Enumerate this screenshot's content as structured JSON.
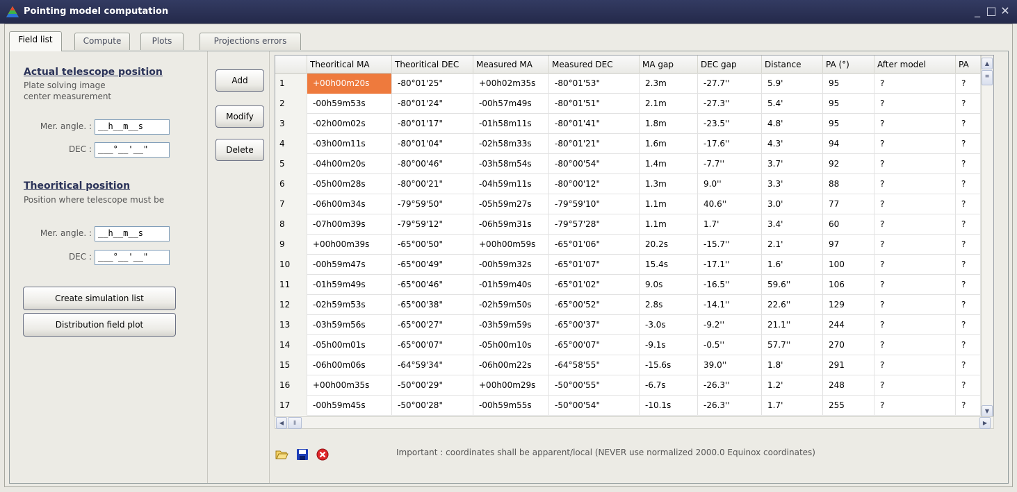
{
  "window": {
    "title": "Pointing model computation"
  },
  "tabs": [
    {
      "label": "Field list"
    },
    {
      "label": "Compute"
    },
    {
      "label": "Plots"
    },
    {
      "label": "Projections errors"
    }
  ],
  "left": {
    "actual_title": "Actual telescope position",
    "actual_desc1": "Plate solving image",
    "actual_desc2": "center measurement",
    "mer_label": "Mer. angle. :",
    "dec_label": "DEC :",
    "mer_placeholder": "__h__m__s",
    "dec_placeholder": "___°__'__\"",
    "theo_title": "Theoritical position",
    "theo_desc": "Position where telescope must be",
    "create_btn": "Create simulation list",
    "dist_btn": "Distribution field plot"
  },
  "actions": {
    "add": "Add",
    "modify": "Modify",
    "delete": "Delete"
  },
  "grid": {
    "columns": [
      "",
      "Theoritical MA",
      "Theoritical DEC",
      "Measured MA",
      "Measured DEC",
      "MA gap",
      "DEC gap",
      "Distance",
      "PA (°)",
      "After model",
      "PA"
    ],
    "rows": [
      [
        "1",
        "+00h00m20s",
        "-80°01'25\"",
        "+00h02m35s",
        "-80°01'53\"",
        "2.3m",
        "-27.7''",
        "5.9'",
        "95",
        "?",
        "?"
      ],
      [
        "2",
        "-00h59m53s",
        "-80°01'24\"",
        "-00h57m49s",
        "-80°01'51\"",
        "2.1m",
        "-27.3''",
        "5.4'",
        "95",
        "?",
        "?"
      ],
      [
        "3",
        "-02h00m02s",
        "-80°01'17\"",
        "-01h58m11s",
        "-80°01'41\"",
        "1.8m",
        "-23.5''",
        "4.8'",
        "95",
        "?",
        "?"
      ],
      [
        "4",
        "-03h00m11s",
        "-80°01'04\"",
        "-02h58m33s",
        "-80°01'21\"",
        "1.6m",
        "-17.6''",
        "4.3'",
        "94",
        "?",
        "?"
      ],
      [
        "5",
        "-04h00m20s",
        "-80°00'46\"",
        "-03h58m54s",
        "-80°00'54\"",
        "1.4m",
        "-7.7''",
        "3.7'",
        "92",
        "?",
        "?"
      ],
      [
        "6",
        "-05h00m28s",
        "-80°00'21\"",
        "-04h59m11s",
        "-80°00'12\"",
        "1.3m",
        "9.0''",
        "3.3'",
        "88",
        "?",
        "?"
      ],
      [
        "7",
        "-06h00m34s",
        "-79°59'50\"",
        "-05h59m27s",
        "-79°59'10\"",
        "1.1m",
        "40.6''",
        "3.0'",
        "77",
        "?",
        "?"
      ],
      [
        "8",
        "-07h00m39s",
        "-79°59'12\"",
        "-06h59m31s",
        "-79°57'28\"",
        "1.1m",
        "1.7'",
        "3.4'",
        "60",
        "?",
        "?"
      ],
      [
        "9",
        "+00h00m39s",
        "-65°00'50\"",
        "+00h00m59s",
        "-65°01'06\"",
        "20.2s",
        "-15.7''",
        "2.1'",
        "97",
        "?",
        "?"
      ],
      [
        "10",
        "-00h59m47s",
        "-65°00'49\"",
        "-00h59m32s",
        "-65°01'07\"",
        "15.4s",
        "-17.1''",
        "1.6'",
        "100",
        "?",
        "?"
      ],
      [
        "11",
        "-01h59m49s",
        "-65°00'46\"",
        "-01h59m40s",
        "-65°01'02\"",
        "9.0s",
        "-16.5''",
        "59.6''",
        "106",
        "?",
        "?"
      ],
      [
        "12",
        "-02h59m53s",
        "-65°00'38\"",
        "-02h59m50s",
        "-65°00'52\"",
        "2.8s",
        "-14.1''",
        "22.6''",
        "129",
        "?",
        "?"
      ],
      [
        "13",
        "-03h59m56s",
        "-65°00'27\"",
        "-03h59m59s",
        "-65°00'37\"",
        "-3.0s",
        "-9.2''",
        "21.1''",
        "244",
        "?",
        "?"
      ],
      [
        "14",
        "-05h00m01s",
        "-65°00'07\"",
        "-05h00m10s",
        "-65°00'07\"",
        "-9.1s",
        "-0.5''",
        "57.7''",
        "270",
        "?",
        "?"
      ],
      [
        "15",
        "-06h00m06s",
        "-64°59'34\"",
        "-06h00m22s",
        "-64°58'55\"",
        "-15.6s",
        "39.0''",
        "1.8'",
        "291",
        "?",
        "?"
      ],
      [
        "16",
        "+00h00m35s",
        "-50°00'29\"",
        "+00h00m29s",
        "-50°00'55\"",
        "-6.7s",
        "-26.3''",
        "1.2'",
        "248",
        "?",
        "?"
      ],
      [
        "17",
        "-00h59m45s",
        "-50°00'28\"",
        "-00h59m55s",
        "-50°00'54\"",
        "-10.1s",
        "-26.3''",
        "1.7'",
        "255",
        "?",
        "?"
      ]
    ]
  },
  "bottom": {
    "note": "Important : coordinates shall be apparent/local (NEVER use normalized 2000.0 Equinox coordinates)",
    "icons": [
      "open-folder-icon",
      "save-icon",
      "delete-icon"
    ]
  },
  "colors": {
    "titlebar": "#2a3052",
    "selection": "#ee7a3d",
    "section_title": "#2b3359"
  }
}
